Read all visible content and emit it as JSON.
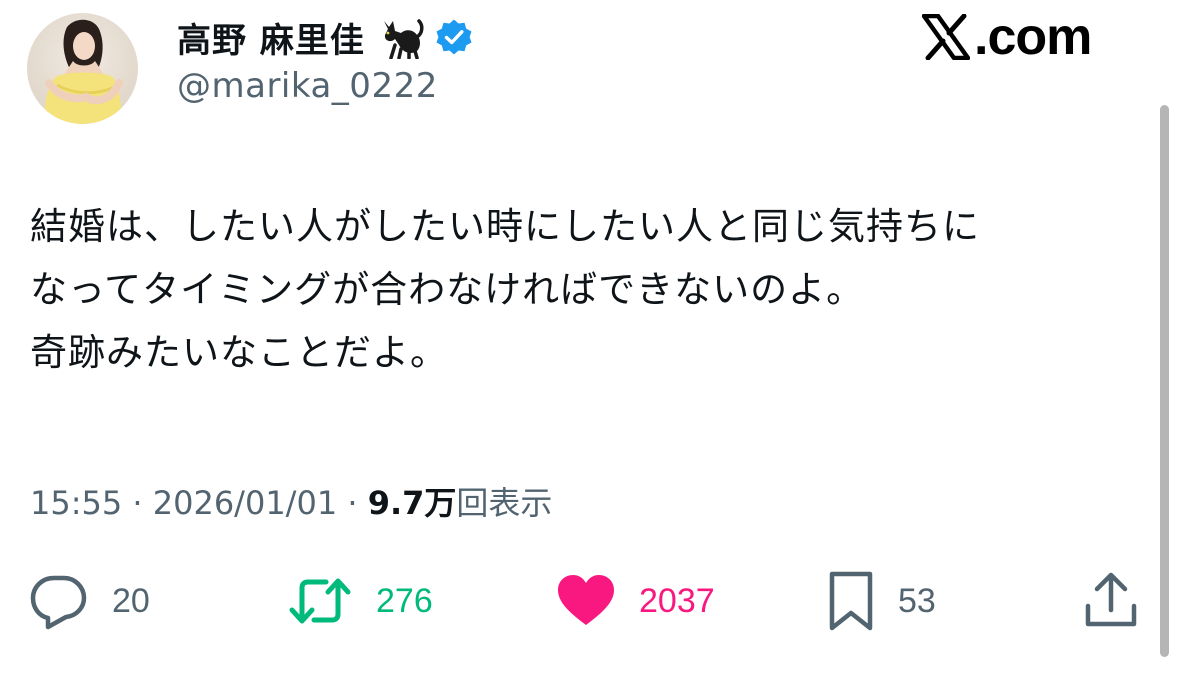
{
  "header": {
    "display_name": "高野 麻里佳",
    "handle": "@marika_0222",
    "site": ".com",
    "icons": [
      "profile-avatar",
      "black-cat-emoji-icon",
      "verified-badge-icon",
      "x-logo-icon"
    ]
  },
  "tweet": {
    "lines": [
      "結婚は、したい人がしたい時にしたい人と同じ気持ちに",
      "なってタイミングが合わなければできないのよ。",
      "奇跡みたいなことだよ。"
    ]
  },
  "meta": {
    "time": "15:55",
    "sep1": " · ",
    "date": "2026/01/01",
    "sep2": " · ",
    "views": "9.7万",
    "views_suffix": "回表示"
  },
  "actions": {
    "reply_count": "20",
    "retweet_count": "276",
    "like_count": "2037",
    "bookmark_count": "53",
    "icons": [
      "reply-icon",
      "retweet-icon",
      "like-heart-icon",
      "bookmark-icon",
      "share-icon"
    ]
  },
  "colors": {
    "text": "#0f1419",
    "secondary": "#536471",
    "verified": "#1d9bf0",
    "retweet": "#00ba7c",
    "like": "#f91880"
  }
}
